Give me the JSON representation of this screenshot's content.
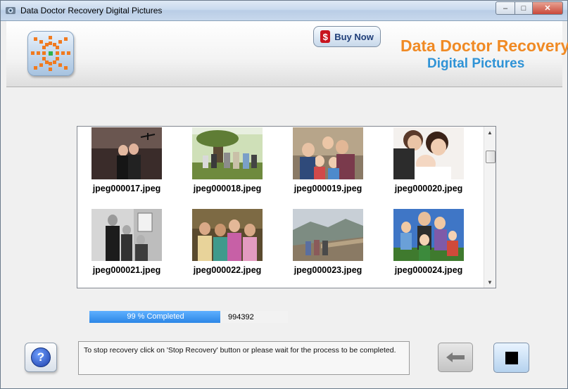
{
  "window": {
    "title": "Data Doctor Recovery Digital Pictures",
    "controls": [
      "minimize",
      "maximize",
      "close"
    ]
  },
  "header": {
    "buy_label": "Buy Now",
    "brand_line1": "Data Doctor Recovery",
    "brand_line2": "Digital Pictures",
    "colors": {
      "brand1": "#f08a24",
      "brand2": "#2f93d6"
    }
  },
  "gallery": {
    "items": [
      {
        "name": "jpeg000017.jpeg",
        "icon": "photo-two-women-indoor"
      },
      {
        "name": "jpeg000018.jpeg",
        "icon": "photo-group-outdoor"
      },
      {
        "name": "jpeg000019.jpeg",
        "icon": "photo-family-portrait"
      },
      {
        "name": "jpeg000020.jpeg",
        "icon": "photo-mother-baby"
      },
      {
        "name": "jpeg000021.jpeg",
        "icon": "photo-family-porch"
      },
      {
        "name": "jpeg000022.jpeg",
        "icon": "photo-four-women"
      },
      {
        "name": "jpeg000023.jpeg",
        "icon": "photo-great-wall"
      },
      {
        "name": "jpeg000024.jpeg",
        "icon": "photo-family-sky"
      }
    ]
  },
  "progress": {
    "label": "99 % Completed",
    "percent": 99,
    "count": "994392"
  },
  "status": {
    "message": "To stop recovery click on 'Stop Recovery' button or please wait for the process to be completed."
  }
}
